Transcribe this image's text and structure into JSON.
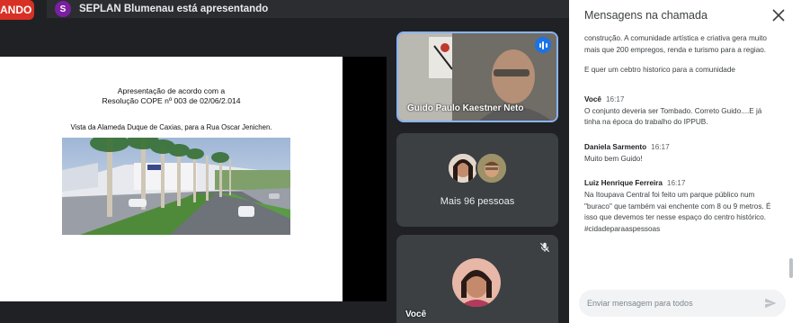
{
  "recording": {
    "label": "ANDO"
  },
  "presenter": {
    "avatar_letter": "S",
    "text": "SEPLAN Blumenau está apresentando"
  },
  "slide": {
    "title_line1": "Apresentação de acordo com a",
    "title_line2": "Resolução COPE nº 003 de 02/06/2.014",
    "caption": "Vista da Alameda Duque de Caxias, para a Rua Oscar Jenichen."
  },
  "tiles": {
    "speaker_name": "Guido Paulo Kaestner Neto",
    "more_people": "Mais 96 pessoas",
    "self_name": "Você"
  },
  "chat": {
    "title": "Mensagens na chamada",
    "messages": {
      "m0_text": "construção. A comunidade artística e criativa gera muito mais que 200 empregos, renda e turismo para a regiao.",
      "m1_text": "E quer um cebtro historico para a comunidade",
      "m2_sender": "Você",
      "m2_time": "16:17",
      "m2_text": "O conjunto deveria ser Tombado. Correto Guido....E já tinha na época do trabalho do IPPUB.",
      "m3_sender": "Daniela Sarmento",
      "m3_time": "16:17",
      "m3_text": "Muito bem Guido!",
      "m4_sender": "Luiz Henrique Ferreira",
      "m4_time": "16:17",
      "m4_text": "Na Itoupava Central foi feito um parque público num \"buraco\" que também vai enchente com 8 ou 9 metros. É isso que devemos ter nesse espaço do centro histórico. #cidadeparaaspessoas"
    },
    "input_placeholder": "Enviar mensagem para todos"
  },
  "colors": {
    "accent": "#8ab4f8",
    "recording": "#d93025",
    "presenter_avatar": "#7b1fa2",
    "speaking": "#1a73e8"
  }
}
